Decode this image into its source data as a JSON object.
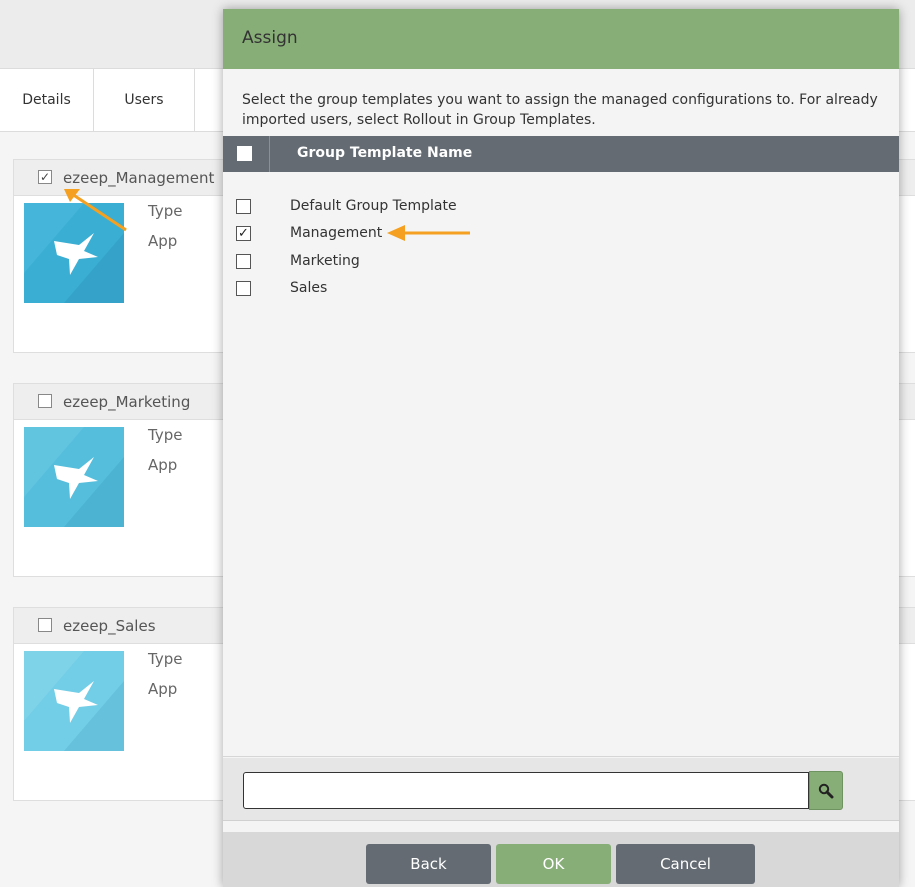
{
  "tabs": [
    {
      "label": "Details"
    },
    {
      "label": "Users"
    }
  ],
  "cards": [
    {
      "title": "ezeep_Management",
      "checked": true,
      "type_label": "Type",
      "app_label": "App"
    },
    {
      "title": "ezeep_Marketing",
      "checked": false,
      "type_label": "Type",
      "app_label": "App"
    },
    {
      "title": "ezeep_Sales",
      "checked": false,
      "type_label": "Type",
      "app_label": "App"
    }
  ],
  "modal": {
    "title": "Assign",
    "description": "Select the group templates you want to assign the managed configurations to. For already imported users, select Rollout in Group Templates.",
    "column_header": "Group Template Name",
    "rows": [
      {
        "label": "Default Group Template",
        "checked": false
      },
      {
        "label": "Management",
        "checked": true
      },
      {
        "label": "Marketing",
        "checked": false
      },
      {
        "label": "Sales",
        "checked": false
      }
    ],
    "search": {
      "value": "",
      "placeholder": ""
    },
    "buttons": {
      "back": "Back",
      "ok": "OK",
      "cancel": "Cancel"
    }
  },
  "colors": {
    "accent_green": "#88ae78",
    "header_gray": "#646b72",
    "annotation_orange": "#f5a020"
  },
  "icons": {
    "card_image": "hummingbird-logo-icon",
    "search": "search-icon",
    "checkmark": "checkmark-icon"
  }
}
